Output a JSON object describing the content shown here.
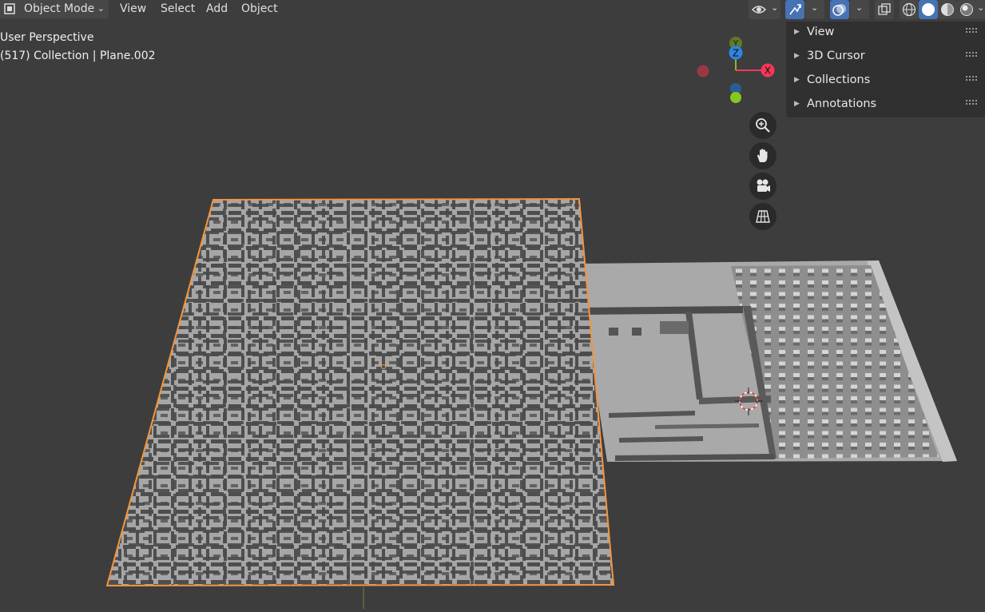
{
  "header": {
    "mode_label": "Object Mode",
    "menus": [
      "View",
      "Select",
      "Add",
      "Object"
    ],
    "icons": [
      "object-mode-icon",
      "visibility-eye-icon",
      "gizmo-arrows-icon",
      "overlays-icon",
      "xray-icon",
      "shading-wireframe-icon",
      "shading-solid-icon",
      "shading-material-icon",
      "shading-rendered-icon"
    ],
    "active_shading": "solid"
  },
  "overlay": {
    "perspective": "User Perspective",
    "collection": "(517) Collection | Plane.002"
  },
  "gizmo": {
    "x_label": "X",
    "y_label": "Y",
    "z_label": "Z",
    "colors": {
      "x": "#f3385a",
      "y": "#86b831",
      "z": "#2f83e3"
    }
  },
  "nav_buttons": [
    "zoom-icon",
    "pan-hand-icon",
    "camera-icon",
    "grid-ortho-icon"
  ],
  "npanel": {
    "sections": [
      "View",
      "3D Cursor",
      "Collections",
      "Annotations"
    ]
  },
  "scene": {
    "selection_color": "#f4943d",
    "objects": [
      "maze-plane",
      "second-plane"
    ]
  }
}
